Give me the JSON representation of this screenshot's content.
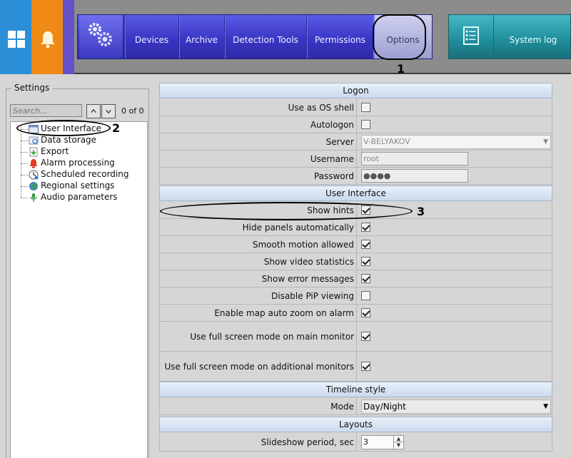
{
  "topbar": {
    "menu": [
      "Devices",
      "Archive",
      "Detection Tools",
      "Permissions",
      "Options"
    ],
    "system_log": "System log",
    "icons": [
      "windows-grid-icon",
      "bell-icon",
      "gears-icon",
      "system-log-icon"
    ]
  },
  "annotations": [
    "1",
    "2",
    "3"
  ],
  "settings": {
    "title": "Settings",
    "search_placeholder": "Search...",
    "count": "0 of 0",
    "tree": [
      {
        "label": "User Interface",
        "icon": "window-icon"
      },
      {
        "label": "Data storage",
        "icon": "storage-icon"
      },
      {
        "label": "Export",
        "icon": "export-icon"
      },
      {
        "label": "Alarm processing",
        "icon": "alarm-icon"
      },
      {
        "label": "Scheduled recording",
        "icon": "schedule-icon"
      },
      {
        "label": "Regional settings",
        "icon": "globe-icon"
      },
      {
        "label": "Audio parameters",
        "icon": "audio-icon"
      }
    ]
  },
  "grid": {
    "logon": {
      "title": "Logon",
      "use_as_os_shell": {
        "label": "Use as OS shell",
        "checked": false
      },
      "autologon": {
        "label": "Autologon",
        "checked": false
      },
      "server": {
        "label": "Server",
        "value": "V-BELYAKOV"
      },
      "username": {
        "label": "Username",
        "value": "root"
      },
      "password": {
        "label": "Password",
        "value": "●●●●"
      }
    },
    "ui": {
      "title": "User Interface",
      "rows": [
        {
          "label": "Show hints",
          "checked": true
        },
        {
          "label": "Hide panels automatically",
          "checked": true
        },
        {
          "label": "Smooth motion allowed",
          "checked": true
        },
        {
          "label": "Show video statistics",
          "checked": true
        },
        {
          "label": "Show error messages",
          "checked": true
        },
        {
          "label": "Disable PiP viewing",
          "checked": false
        },
        {
          "label": "Enable map auto zoom on alarm",
          "checked": true
        },
        {
          "label": "Use full screen mode on main monitor",
          "checked": true
        },
        {
          "label": "Use full screen mode on additional monitors",
          "checked": true
        }
      ]
    },
    "timeline": {
      "title": "Timeline style",
      "mode_label": "Mode",
      "mode_value": "Day/Night"
    },
    "layouts": {
      "title": "Layouts",
      "slideshow_label": "Slideshow period, sec",
      "slideshow_value": "3"
    }
  }
}
